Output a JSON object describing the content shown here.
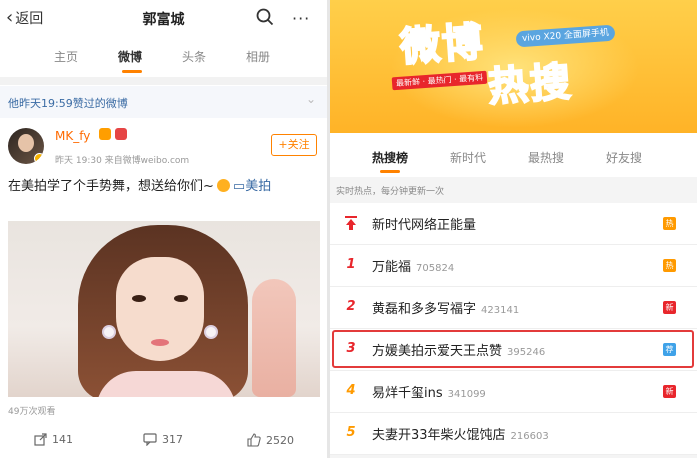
{
  "left": {
    "header": {
      "back_label": "返回",
      "title": "郭富城",
      "more": "···"
    },
    "tabs": [
      {
        "label": "主页"
      },
      {
        "label": "微博"
      },
      {
        "label": "头条"
      },
      {
        "label": "相册"
      }
    ],
    "liked_bar": "他昨天19:59赞过的微博",
    "post": {
      "username": "MK_fy",
      "meta": "昨天 19:30  来自微博weibo.com",
      "follow_label": "+关注",
      "text_main": "在美拍学了个手势舞，想送给你们~",
      "text_link": "美拍",
      "views": "49万次观看",
      "repost_count": "141",
      "comment_count": "317",
      "like_count": "2520"
    }
  },
  "right": {
    "banner": {
      "title_line1": "微博",
      "title_line2": "热搜",
      "sponsor": "vivo X20 全面屏手机",
      "slogan": "最新鲜 · 最热门 · 最有料"
    },
    "tabs": [
      {
        "label": "热搜榜"
      },
      {
        "label": "新时代"
      },
      {
        "label": "最热搜"
      },
      {
        "label": "好友搜"
      }
    ],
    "note": "实时热点，每分钟更新一次",
    "items": [
      {
        "rank": "",
        "title": "新时代网络正能量",
        "count": "",
        "badge": "热",
        "badge_color": "#ff9a00"
      },
      {
        "rank": "1",
        "title": "万能福",
        "count": "705824",
        "badge": "热",
        "badge_color": "#ff9a00",
        "rank_color": "#e8262c"
      },
      {
        "rank": "2",
        "title": "黄磊和多多写福字",
        "count": "423141",
        "badge": "新",
        "badge_color": "#e8262c",
        "rank_color": "#e8262c"
      },
      {
        "rank": "3",
        "title": "方媛美拍示爱天王点赞",
        "count": "395246",
        "badge": "荐",
        "badge_color": "#3fa2e8",
        "rank_color": "#e8262c"
      },
      {
        "rank": "4",
        "title": "易烊千玺ins",
        "count": "341099",
        "badge": "新",
        "badge_color": "#e8262c",
        "rank_color": "#ff9a00"
      },
      {
        "rank": "5",
        "title": "夫妻开33年柴火馄饨店",
        "count": "216603",
        "badge": "",
        "badge_color": "",
        "rank_color": "#ff9a00"
      }
    ]
  }
}
